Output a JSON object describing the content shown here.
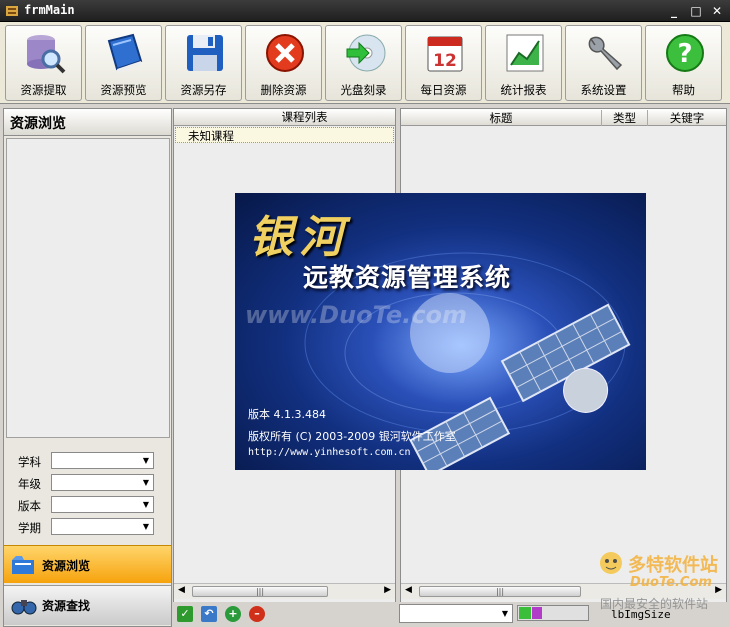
{
  "window": {
    "title": "frmMain",
    "min": "_",
    "max": "□",
    "close": "✕"
  },
  "toolbar": [
    {
      "label": "资源提取",
      "icon": "database-search-icon"
    },
    {
      "label": "资源预览",
      "icon": "book-icon"
    },
    {
      "label": "资源另存",
      "icon": "floppy-disk-icon"
    },
    {
      "label": "删除资源",
      "icon": "delete-icon"
    },
    {
      "label": "光盘刻录",
      "icon": "cd-burn-icon"
    },
    {
      "label": "每日资源",
      "icon": "calendar-icon"
    },
    {
      "label": "统计报表",
      "icon": "chart-icon"
    },
    {
      "label": "系统设置",
      "icon": "wrench-icon"
    },
    {
      "label": "帮助",
      "icon": "help-icon"
    }
  ],
  "calendar_day": "12",
  "left_panel": {
    "title": "资源浏览",
    "filters": [
      {
        "label": "学科",
        "value": ""
      },
      {
        "label": "年级",
        "value": ""
      },
      {
        "label": "版本",
        "value": ""
      },
      {
        "label": "学期",
        "value": ""
      }
    ],
    "nav": [
      {
        "label": "资源浏览"
      },
      {
        "label": "资源查找"
      }
    ]
  },
  "middle_panel": {
    "header": "课程列表",
    "rows": [
      "未知课程"
    ]
  },
  "right_panel": {
    "columns": [
      "标题",
      "类型",
      "关键字"
    ]
  },
  "scroll_thumb": "|||",
  "status": {
    "img_label": "lbImgSize"
  },
  "splash": {
    "title": "银河",
    "subtitle": "远教资源管理系统",
    "version": "版本  4.1.3.484",
    "copyright": "版权所有 (C) 2003-2009  银河软件工作室",
    "url": "http://www.yinhesoft.com.cn",
    "watermark": "www.DuoTe.com"
  },
  "watermark_logo": {
    "line1": "多特软件站",
    "line2": "DuoTe.Com",
    "line3": "国内最安全的软件站"
  },
  "colors": {
    "titlebar": "#2b2b2b",
    "nav_active": "#f6a30d",
    "splash_bg": "#1a3a9a"
  }
}
